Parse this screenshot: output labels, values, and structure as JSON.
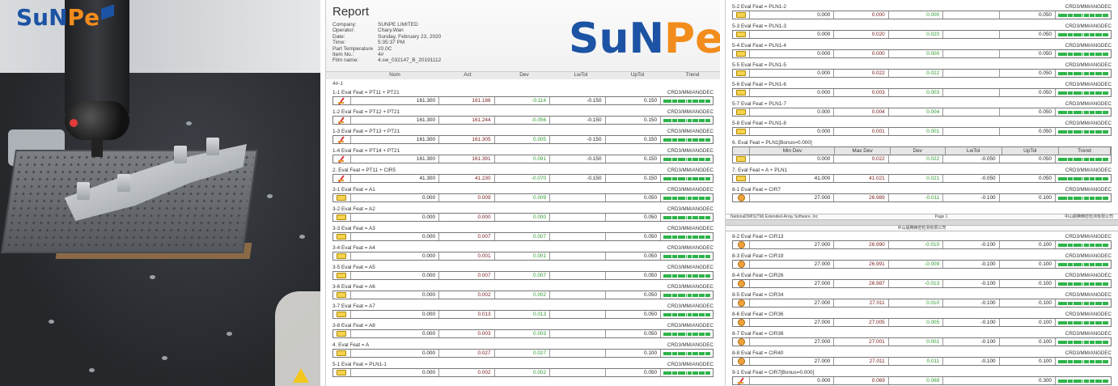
{
  "brand": {
    "logo_text_blue": "SuN",
    "logo_text_orange": "Pe"
  },
  "report": {
    "title": "Report",
    "meta": [
      {
        "k": "Company:",
        "v": "SUNPE LIMITED"
      },
      {
        "k": "Operator:",
        "v": "Chary.Wan"
      },
      {
        "k": "Date:",
        "v": "Sunday, February 23, 2020"
      },
      {
        "k": "Time:",
        "v": "5:35:37 PM"
      },
      {
        "k": "Part Temperature",
        "v": "20.0C"
      },
      {
        "k": "Item No.:",
        "v": "4#"
      },
      {
        "k": "Film name:",
        "v": "4.sw_032147_B_20191112"
      }
    ],
    "columns": [
      "Nom",
      "Act",
      "Dev",
      "LwTol",
      "UpTol",
      "Trend"
    ],
    "section_label": "4#-1",
    "crd": "CRD3/MM/ANGDEC"
  },
  "features_p1": [
    {
      "id": "1-1",
      "name": "Eval Feat = PT11 + PT21",
      "icon": "slash",
      "nom": "161.300",
      "act": "161.186",
      "dev": "-0.114",
      "lw": "-0.150",
      "up": "0.150"
    },
    {
      "id": "1-2",
      "name": "Eval Feat = PT12 + PT21",
      "icon": "slash",
      "nom": "161.300",
      "act": "161.244",
      "dev": "-0.056",
      "lw": "-0.150",
      "up": "0.150"
    },
    {
      "id": "1-3",
      "name": "Eval Feat = PT13 + PT21",
      "icon": "slash",
      "nom": "161.300",
      "act": "161.305",
      "dev": "0.005",
      "lw": "-0.150",
      "up": "0.150"
    },
    {
      "id": "1-4",
      "name": "Eval Feat = PT14 + PT21",
      "icon": "slash",
      "nom": "161.300",
      "act": "161.391",
      "dev": "0.091",
      "lw": "-0.150",
      "up": "0.150"
    },
    {
      "id": "2.",
      "name": "Eval Feat = PT11 + CIR5",
      "icon": "slash",
      "nom": "41.300",
      "act": "41.230",
      "dev": "-0.070",
      "lw": "-0.150",
      "up": "0.150"
    },
    {
      "id": "3-1",
      "name": "Eval Feat = A1",
      "icon": "box",
      "nom": "0.000",
      "act": "0.009",
      "dev": "0.009",
      "lw": "",
      "up": "0.050"
    },
    {
      "id": "3-2",
      "name": "Eval Feat = A2",
      "icon": "box",
      "nom": "0.000",
      "act": "0.000",
      "dev": "0.000",
      "lw": "",
      "up": "0.050"
    },
    {
      "id": "3-3",
      "name": "Eval Feat = A3",
      "icon": "box",
      "nom": "0.000",
      "act": "0.007",
      "dev": "0.007",
      "lw": "",
      "up": "0.050"
    },
    {
      "id": "3-4",
      "name": "Eval Feat = A4",
      "icon": "box",
      "nom": "0.000",
      "act": "0.001",
      "dev": "0.001",
      "lw": "",
      "up": "0.050"
    },
    {
      "id": "3-5",
      "name": "Eval Feat = A5",
      "icon": "box",
      "nom": "0.000",
      "act": "0.007",
      "dev": "0.007",
      "lw": "",
      "up": "0.050"
    },
    {
      "id": "3-6",
      "name": "Eval Feat = A6",
      "icon": "box",
      "nom": "0.000",
      "act": "0.002",
      "dev": "0.002",
      "lw": "",
      "up": "0.050"
    },
    {
      "id": "3-7",
      "name": "Eval Feat = A7",
      "icon": "box",
      "nom": "0.000",
      "act": "0.013",
      "dev": "0.013",
      "lw": "",
      "up": "0.050"
    },
    {
      "id": "3-8",
      "name": "Eval Feat = A8",
      "icon": "box",
      "nom": "0.000",
      "act": "0.003",
      "dev": "0.003",
      "lw": "",
      "up": "0.050"
    },
    {
      "id": "4.",
      "name": "Eval Feat = A",
      "icon": "box",
      "nom": "0.000",
      "act": "0.027",
      "dev": "0.027",
      "lw": "",
      "up": "0.100"
    },
    {
      "id": "5-1",
      "name": "Eval Feat = PLN1-1",
      "icon": "box",
      "nom": "0.000",
      "act": "0.002",
      "dev": "0.002",
      "lw": "",
      "up": "0.050"
    }
  ],
  "features_p2a": [
    {
      "id": "5-2",
      "name": "Eval Feat = PLN1-2",
      "icon": "box",
      "nom": "0.000",
      "act": "0.000",
      "dev": "0.000",
      "lw": "",
      "up": "0.050"
    },
    {
      "id": "5-3",
      "name": "Eval Feat = PLN1-3",
      "icon": "box",
      "nom": "0.000",
      "act": "0.020",
      "dev": "0.020",
      "lw": "",
      "up": "0.050"
    },
    {
      "id": "5-4",
      "name": "Eval Feat = PLN1-4",
      "icon": "box",
      "nom": "0.000",
      "act": "0.000",
      "dev": "0.000",
      "lw": "",
      "up": "0.050"
    },
    {
      "id": "5-5",
      "name": "Eval Feat = PLN1-5",
      "icon": "box",
      "nom": "0.000",
      "act": "0.022",
      "dev": "0.022",
      "lw": "",
      "up": "0.050"
    },
    {
      "id": "5-6",
      "name": "Eval Feat = PLN1-6",
      "icon": "box",
      "nom": "0.000",
      "act": "0.003",
      "dev": "0.003",
      "lw": "",
      "up": "0.050"
    },
    {
      "id": "5-7",
      "name": "Eval Feat = PLN1-7",
      "icon": "box",
      "nom": "0.000",
      "act": "0.004",
      "dev": "0.004",
      "lw": "",
      "up": "0.050"
    },
    {
      "id": "5-8",
      "name": "Eval Feat = PLN1-8",
      "icon": "box",
      "nom": "0.000",
      "act": "0.001",
      "dev": "0.001",
      "lw": "",
      "up": "0.050"
    }
  ],
  "flatness": {
    "label": "6. Eval Feat = PLN1[Bonus=0.000]",
    "columns": [
      "Min Dev",
      "Max Dev",
      "Dev",
      "LwTol",
      "UpTol",
      "Trend"
    ],
    "values": {
      "min": "0.000",
      "max": "0.022",
      "dev": "0.022",
      "lw": "-0.050",
      "up": "0.050"
    }
  },
  "features_p2b": [
    {
      "id": "7.",
      "name": "Eval Feat = A + PLN1",
      "icon": "box",
      "nom": "41.000",
      "act": "41.021",
      "dev": "0.021",
      "lw": "-0.050",
      "up": "0.050"
    },
    {
      "id": "8-1",
      "name": "Eval Feat = CIR7",
      "icon": "circ",
      "nom": "27.000",
      "act": "26.989",
      "dev": "-0.011",
      "lw": "-0.100",
      "up": "0.100"
    }
  ],
  "page_footer": {
    "left": "NationalDMIS(TM) Extended-Array Software, Inc",
    "center": "Page 1",
    "right": "中山晨腾精密检测有限公司"
  },
  "page2_header": "中山晨腾精密检测有限公司",
  "features_p2c": [
    {
      "id": "8-2",
      "name": "Eval Feat = CIR13",
      "icon": "circ",
      "nom": "27.000",
      "act": "26.990",
      "dev": "-0.010",
      "lw": "-0.100",
      "up": "0.100"
    },
    {
      "id": "8-3",
      "name": "Eval Feat = CIR19",
      "icon": "circ",
      "nom": "27.000",
      "act": "26.991",
      "dev": "-0.009",
      "lw": "-0.100",
      "up": "0.100"
    },
    {
      "id": "8-4",
      "name": "Eval Feat = CIR26",
      "icon": "circ",
      "nom": "27.000",
      "act": "26.987",
      "dev": "-0.013",
      "lw": "-0.100",
      "up": "0.100"
    },
    {
      "id": "8-5",
      "name": "Eval Feat = CIR34",
      "icon": "circ",
      "nom": "27.000",
      "act": "27.011",
      "dev": "0.010",
      "lw": "-0.100",
      "up": "0.100"
    },
    {
      "id": "8-6",
      "name": "Eval Feat = CIR36",
      "icon": "circ",
      "nom": "27.000",
      "act": "27.005",
      "dev": "0.005",
      "lw": "-0.100",
      "up": "0.100"
    },
    {
      "id": "8-7",
      "name": "Eval Feat = CIR38",
      "icon": "circ",
      "nom": "27.000",
      "act": "27.001",
      "dev": "0.001",
      "lw": "-0.100",
      "up": "0.100"
    },
    {
      "id": "8-8",
      "name": "Eval Feat = CIR40",
      "icon": "circ",
      "nom": "27.000",
      "act": "27.011",
      "dev": "0.011",
      "lw": "-0.100",
      "up": "0.100"
    }
  ],
  "last_feature": {
    "label": "9-1 Eval Feat = CIR7[Bonus=0.000]",
    "icon": "slash",
    "nom": "0.000",
    "act": "0.069",
    "dev": "0.069",
    "up": "0.300"
  },
  "colors": {
    "brand_blue": "#1c53a4",
    "brand_orange": "#f28c1c",
    "dev_green": "#2e9a2e",
    "act_red": "#7b2020",
    "trend_green": "#2fb44a"
  }
}
